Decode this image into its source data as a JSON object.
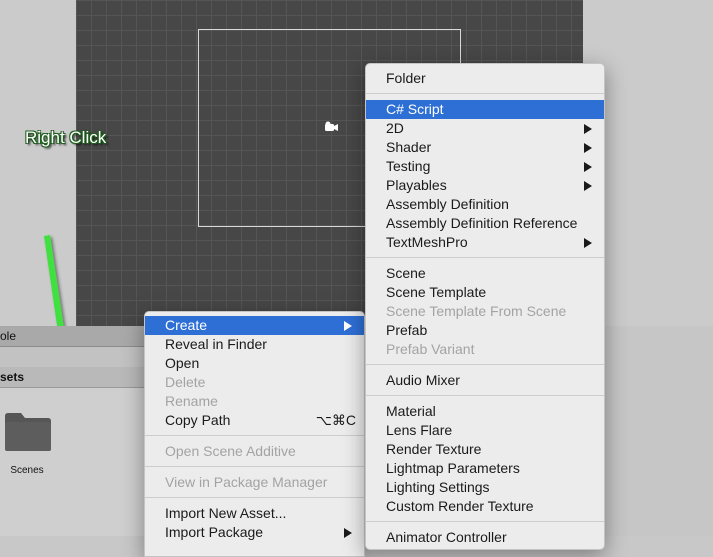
{
  "annotation": {
    "text": "Right Click",
    "arrow_color": "#3fe03f"
  },
  "panel": {
    "tab_label": "ole",
    "assets_label": "sets",
    "folder": {
      "icon": "folder-icon",
      "label": "Scenes"
    }
  },
  "context_menu": {
    "highlight_color": "#2e6fd6",
    "items": [
      {
        "label": "Create",
        "highlighted": true,
        "submenu": true
      },
      {
        "label": "Reveal in Finder"
      },
      {
        "label": "Open"
      },
      {
        "label": "Delete",
        "disabled": true
      },
      {
        "label": "Rename",
        "disabled": true
      },
      {
        "label": "Copy Path",
        "shortcut": "⌥⌘C"
      },
      {
        "label": "Open Scene Additive",
        "disabled": true
      },
      {
        "label": "View in Package Manager",
        "disabled": true
      },
      {
        "label": "Import New Asset..."
      },
      {
        "label": "Import Package",
        "submenu": true
      }
    ]
  },
  "create_submenu": {
    "items": [
      {
        "label": "Folder"
      },
      {
        "label": "C# Script",
        "highlighted": true
      },
      {
        "label": "2D",
        "submenu": true
      },
      {
        "label": "Shader",
        "submenu": true
      },
      {
        "label": "Testing",
        "submenu": true
      },
      {
        "label": "Playables",
        "submenu": true
      },
      {
        "label": "Assembly Definition"
      },
      {
        "label": "Assembly Definition Reference"
      },
      {
        "label": "TextMeshPro",
        "submenu": true
      },
      {
        "label": "Scene"
      },
      {
        "label": "Scene Template"
      },
      {
        "label": "Scene Template From Scene",
        "disabled": true
      },
      {
        "label": "Prefab"
      },
      {
        "label": "Prefab Variant",
        "disabled": true
      },
      {
        "label": "Audio Mixer"
      },
      {
        "label": "Material"
      },
      {
        "label": "Lens Flare"
      },
      {
        "label": "Render Texture"
      },
      {
        "label": "Lightmap Parameters"
      },
      {
        "label": "Lighting Settings"
      },
      {
        "label": "Custom Render Texture"
      },
      {
        "label": "Animator Controller"
      }
    ]
  }
}
